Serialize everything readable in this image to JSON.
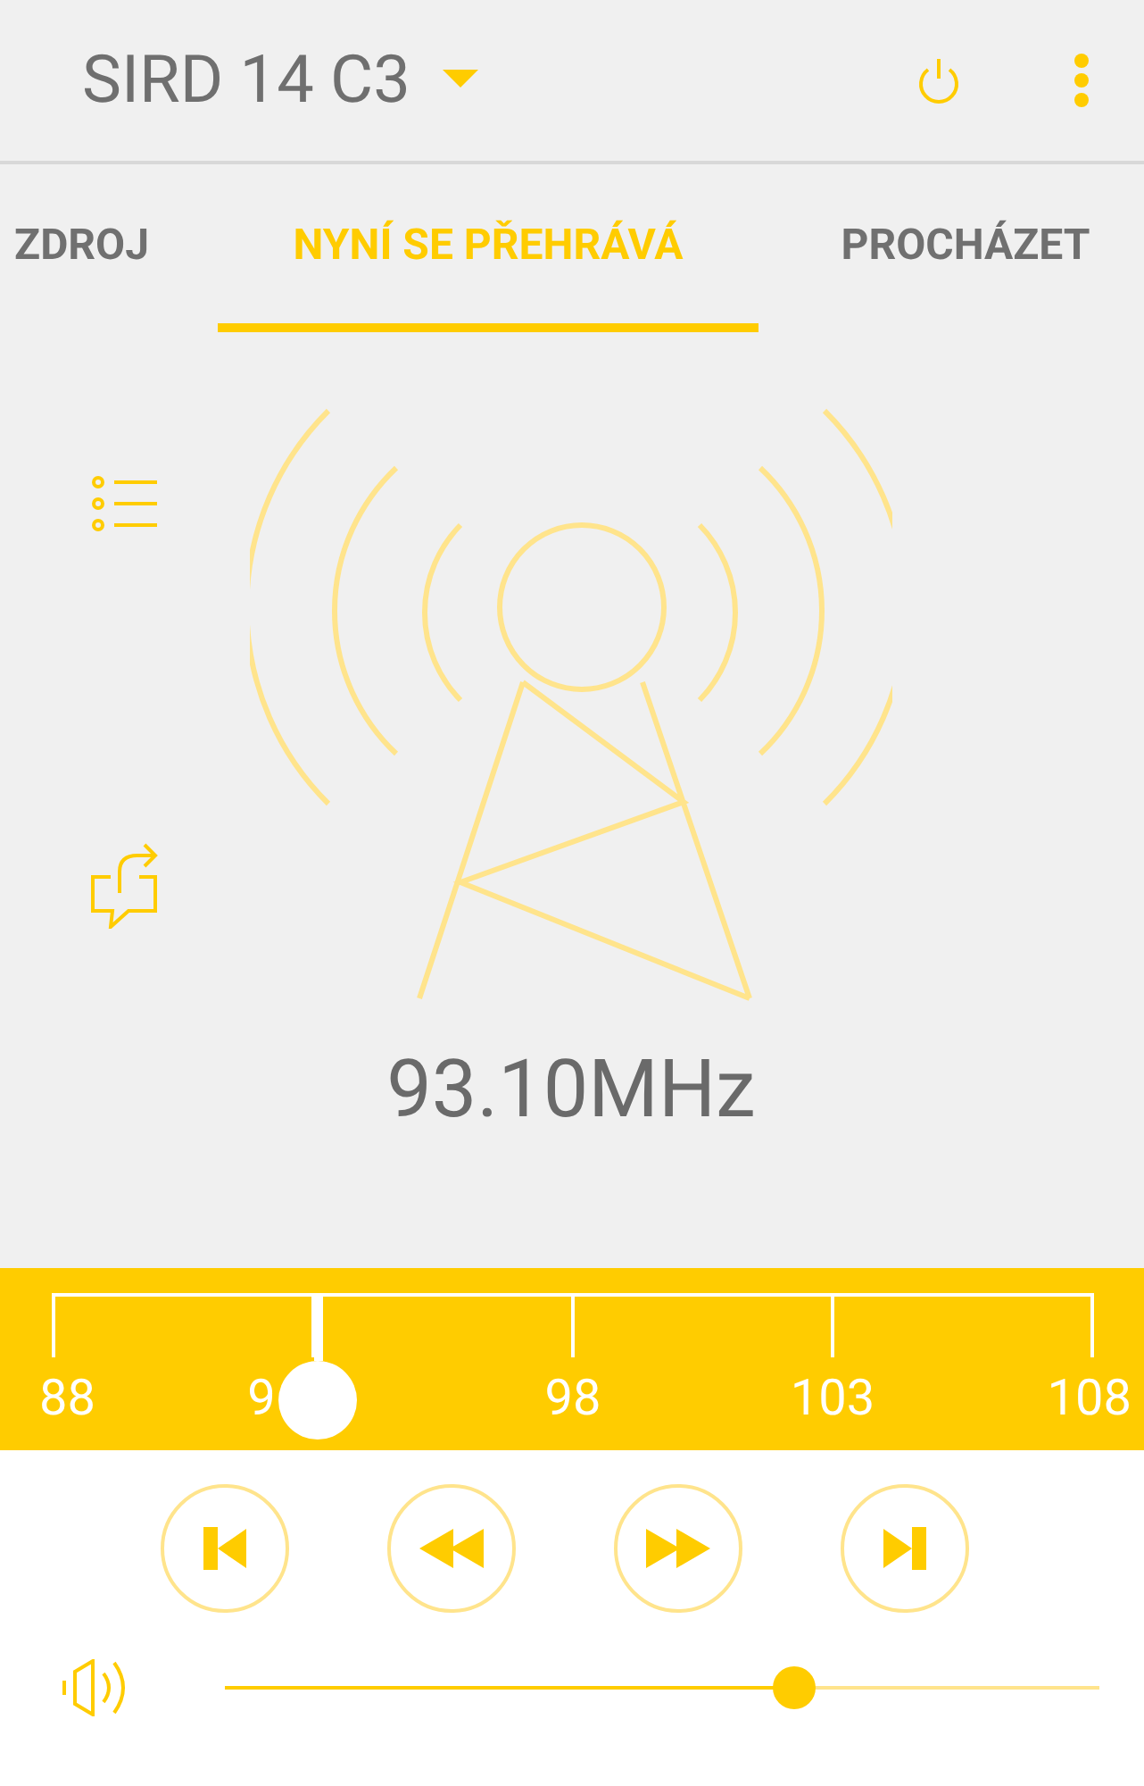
{
  "header": {
    "device": "SIRD 14 C3"
  },
  "tabs": [
    {
      "label": "ZDROJ",
      "selected": false
    },
    {
      "label": "NYNÍ SE PŘEHRÁVÁ",
      "selected": true
    },
    {
      "label": "PROCHÁZET",
      "selected": false
    }
  ],
  "frequency": "93.10MHz",
  "tuner": {
    "level": 0.255,
    "labels": [
      "88",
      "9",
      "98",
      "103",
      "108"
    ]
  },
  "volume": {
    "level": 0.65
  }
}
